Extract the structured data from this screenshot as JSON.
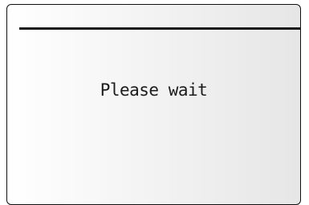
{
  "dialog": {
    "message": "Please wait"
  },
  "colors": {
    "frame_border": "#111111",
    "header_rule": "#1a1a1a",
    "text": "#1c1c1c"
  }
}
